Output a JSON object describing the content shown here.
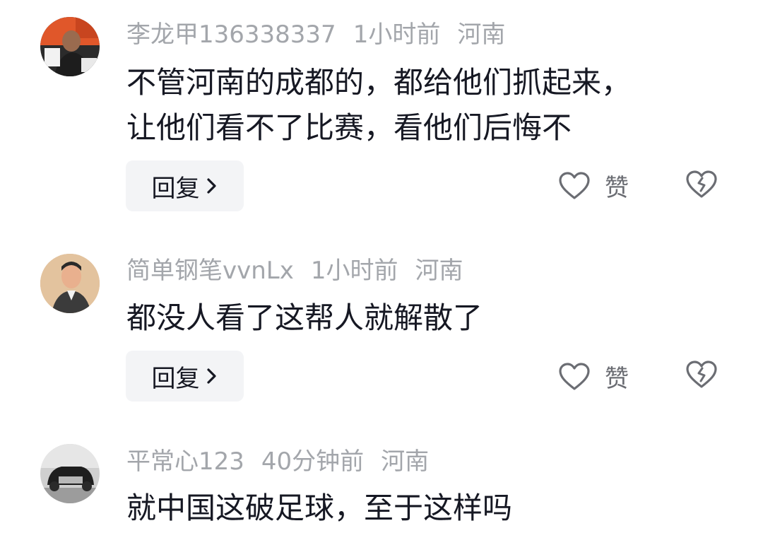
{
  "comments": [
    {
      "username": "李龙甲136338337",
      "time": "1小时前",
      "location": "河南",
      "lines": [
        "不管河南的成都的，都给他们抓起来，",
        "让他们看不了比赛，看他们后悔不"
      ],
      "reply_label": "回复",
      "like_label": "赞"
    },
    {
      "username": "简单钢笔vvnLx",
      "time": "1小时前",
      "location": "河南",
      "lines": [
        "都没人看了这帮人就解散了"
      ],
      "reply_label": "回复",
      "like_label": "赞"
    },
    {
      "username": "平常心123",
      "time": "40分钟前",
      "location": "河南",
      "lines": [
        "就中国这破足球，至于这样吗"
      ]
    }
  ],
  "icons": {
    "reply_chevron": "chevron-right-icon",
    "like": "heart-icon",
    "dislike": "broken-heart-icon"
  },
  "colors": {
    "meta_text": "#a3a6ab",
    "body_text": "#161823",
    "reply_bg": "#f3f4f6",
    "icon": "#6b6d73"
  }
}
